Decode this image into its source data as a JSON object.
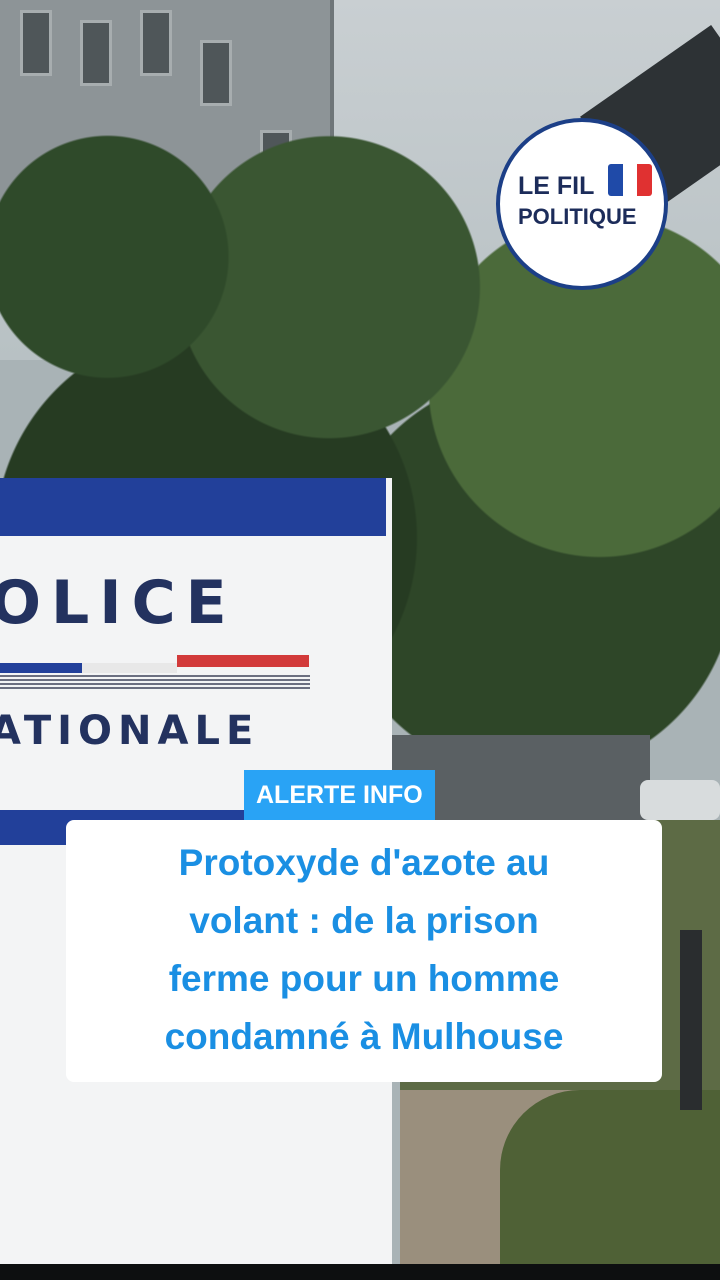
{
  "brand": {
    "logo_line1": "LE FIL",
    "logo_line2": "POLITIQUE",
    "flag_colors": [
      "#1f4aa8",
      "#ffffff",
      "#e03131"
    ]
  },
  "scene": {
    "sign_text_1": "OLICE",
    "sign_text_2": "ATIONALE"
  },
  "alert": {
    "badge": "ALERTE INFO",
    "headline_lines": [
      "Protoxyde d'azote au",
      "volant : de la prison",
      "ferme pour un homme",
      "condamné à Mulhouse"
    ]
  },
  "colors": {
    "badge_bg": "#29a3f5",
    "headline_text": "#1a8fe3",
    "logo_border": "#1c3f87"
  }
}
